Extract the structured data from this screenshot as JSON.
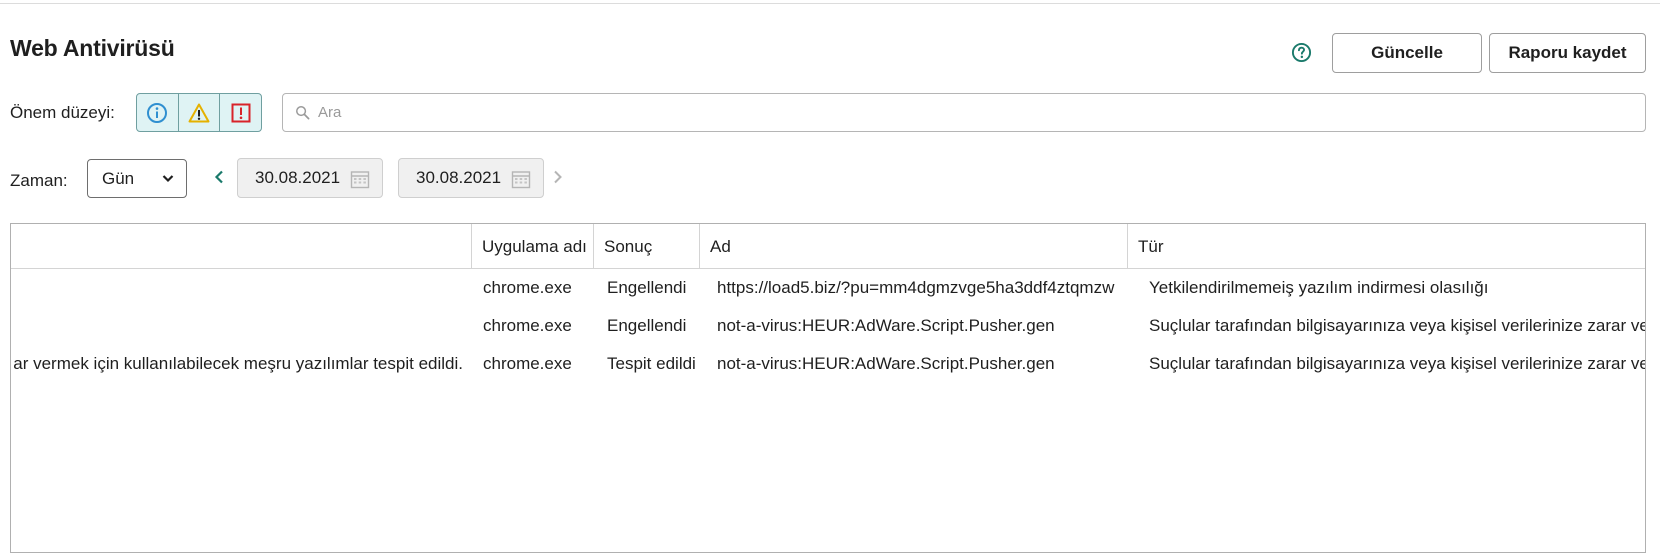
{
  "page": {
    "title": "Web Antivirüsü",
    "help_icon": "question-circle-icon"
  },
  "toolbar": {
    "refresh_label": "Güncelle",
    "save_report_label": "Raporu kaydet"
  },
  "filters": {
    "severity_label": "Önem düzeyi:",
    "severity_icons": [
      "info-icon",
      "warning-icon",
      "critical-icon"
    ],
    "search_placeholder": "Ara",
    "time_label": "Zaman:",
    "period_value": "Gün",
    "date_from": "30.08.2021",
    "date_to": "30.08.2021"
  },
  "colors": {
    "accent_teal": "#1a7a6b",
    "severity_bg": "#dff3f4",
    "info_blue": "#2f8fd0",
    "warning_yellow": "#e5b100",
    "critical_red": "#d8232a"
  },
  "table": {
    "columns": [
      "",
      "Uygulama adı",
      "Sonuç",
      "Ad",
      "Tür"
    ],
    "rows": [
      {
        "description": "",
        "app": "chrome.exe",
        "result": "Engellendi",
        "name": "https://load5.biz/?pu=mm4dgmzvge5ha3ddf4ztqmzw",
        "type": "Yetkilendirilmemeiş yazılım indirmesi olasılığı"
      },
      {
        "description": "",
        "app": "chrome.exe",
        "result": "Engellendi",
        "name": "not-a-virus:HEUR:AdWare.Script.Pusher.gen",
        "type": "Suçlular tarafından bilgisayarınıza veya kişisel verilerinize zarar ve"
      },
      {
        "description": "ar vermek için kullanılabilecek meşru yazılımlar tespit edildi.",
        "app": "chrome.exe",
        "result": "Tespit edildi",
        "name": "not-a-virus:HEUR:AdWare.Script.Pusher.gen",
        "type": "Suçlular tarafından bilgisayarınıza veya kişisel verilerinize zarar ve"
      }
    ]
  }
}
